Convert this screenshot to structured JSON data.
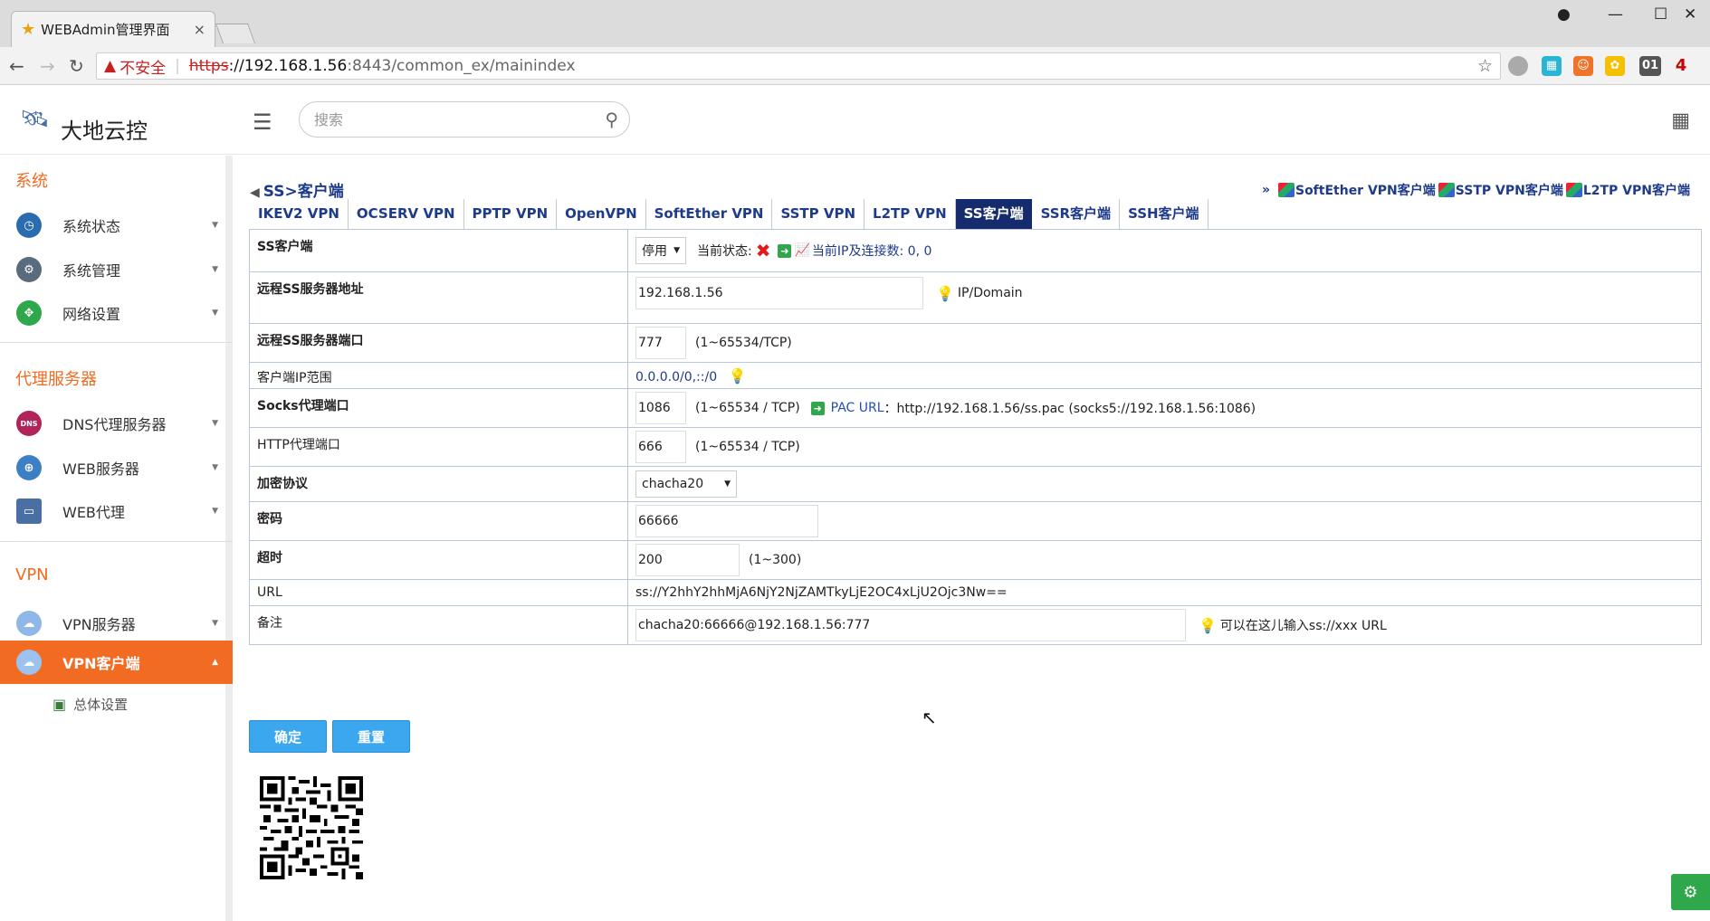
{
  "browser": {
    "tab_title": "WEBAdmin管理界面",
    "tab_close": "×",
    "url_insecure_label": "不安全",
    "url_scheme": "https",
    "url_host": "://192.168.1.56",
    "url_path": ":8443/common_ex/mainindex",
    "ext_badge": "4",
    "ext_01": "01"
  },
  "header": {
    "logo_text": "大地云控",
    "search_placeholder": "搜索"
  },
  "sidebar": {
    "sections": [
      {
        "title": "系统",
        "items": [
          {
            "label": "系统状态",
            "icon": "dashboard-icon"
          },
          {
            "label": "系统管理",
            "icon": "gear-icon"
          },
          {
            "label": "网络设置",
            "icon": "network-icon"
          }
        ]
      },
      {
        "title": "代理服务器",
        "items": [
          {
            "label": "DNS代理服务器",
            "icon": "dns-icon"
          },
          {
            "label": "WEB服务器",
            "icon": "www-icon"
          },
          {
            "label": "WEB代理",
            "icon": "monitor-icon"
          }
        ]
      },
      {
        "title": "VPN",
        "items": [
          {
            "label": "VPN服务器",
            "icon": "cloud-lightning-icon"
          },
          {
            "label": "VPN客户端",
            "icon": "cloud-icon"
          }
        ]
      }
    ],
    "sub_item": "总体设置",
    "dns_badge": "DNS"
  },
  "content": {
    "breadcrumb": "SS>客户端",
    "quick_prefix": "»",
    "quick_links": [
      "SoftEther VPN客户端",
      "SSTP VPN客户端",
      "L2TP VPN客户端"
    ],
    "tabs": [
      "IKEV2 VPN",
      "OCSERV VPN",
      "PPTP VPN",
      "OpenVPN",
      "SoftEther VPN",
      "SSTP VPN",
      "L2TP VPN",
      "SS客户端",
      "SSR客户端",
      "SSH客户端"
    ],
    "active_tab": "SS客户端",
    "form": {
      "ss_client_label": "SS客户端",
      "ss_client_select": "停用",
      "status_label": "当前状态:",
      "status_value": "✖",
      "ip_conn_link": "当前IP及连接数: 0, 0",
      "server_addr_label": "远程SS服务器地址",
      "server_addr_value": "192.168.1.56",
      "server_addr_hint": "IP/Domain",
      "server_port_label": "远程SS服务器端口",
      "server_port_value": "777",
      "server_port_hint": "(1~65534/TCP)",
      "ip_range_label": "客户端IP范围",
      "ip_range_value": "0.0.0.0/0,::/0",
      "socks_label": "Socks代理端口",
      "socks_value": "1086",
      "socks_hint": "(1~65534 / TCP)",
      "pac_label": "PAC URL",
      "pac_value": "：http://192.168.1.56/ss.pac (socks5://192.168.1.56:1086)",
      "http_label": "HTTP代理端口",
      "http_value": "666",
      "http_hint": "(1~65534 / TCP)",
      "cipher_label": "加密协议",
      "cipher_value": "chacha20",
      "password_label": "密码",
      "password_value": "66666",
      "timeout_label": "超时",
      "timeout_value": "200",
      "timeout_hint": "(1~300)",
      "url_label": "URL",
      "url_value": "ss://Y2hhY2hhMjA6NjY2NjZAMTkyLjE2OC4xLjU2Ojc3Nw==",
      "note_label": "备注",
      "note_value": "chacha20:66666@192.168.1.56:777",
      "note_hint": "可以在这儿输入ss://xxx URL"
    },
    "buttons": {
      "confirm": "确定",
      "reset": "重置"
    }
  }
}
